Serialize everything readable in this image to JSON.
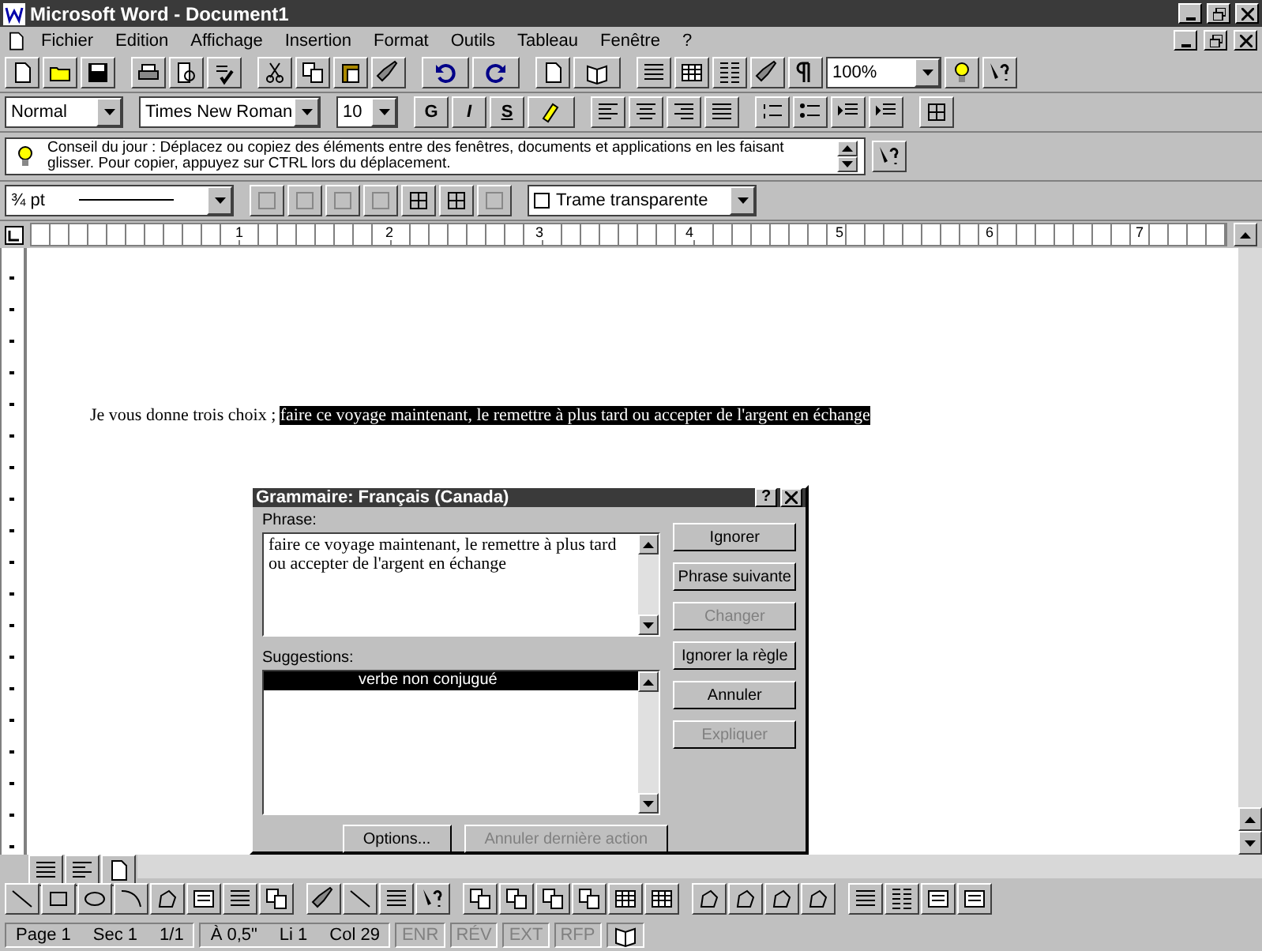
{
  "window": {
    "title": "Microsoft Word - Document1"
  },
  "menu": [
    "Fichier",
    "Edition",
    "Affichage",
    "Insertion",
    "Format",
    "Outils",
    "Tableau",
    "Fenêtre",
    "?"
  ],
  "standard_toolbar": {
    "zoom": "100%"
  },
  "formatting_toolbar": {
    "style": "Normal",
    "font": "Times New Roman",
    "size": "10",
    "bold": "G",
    "italic": "I",
    "underline": "S"
  },
  "tip_of_the_day": {
    "text": "Conseil du jour : Déplacez ou copiez des éléments entre des fenêtres, documents et applications en les faisant glisser. Pour copier, appuyez sur CTRL lors du déplacement."
  },
  "borders_toolbar": {
    "line_weight": "¾ pt",
    "shading": "Trame transparente"
  },
  "ruler": [
    "1",
    "2",
    "3",
    "4",
    "5",
    "6",
    "7"
  ],
  "document": {
    "text": "Je vous donne trois choix ; ",
    "selected_text": "faire ce voyage maintenant, le remettre à plus tard ou accepter de l'argent en échange"
  },
  "dialog": {
    "title": "Grammaire: Français (Canada)",
    "help": "?",
    "phrase_label": "Phrase:",
    "phrase": "faire ce voyage maintenant, le remettre à plus tard ou accepter de l'argent en échange",
    "suggestions_label": "Suggestions:",
    "suggestions": [
      {
        "text": "verbe non conjugué",
        "selected": true
      }
    ],
    "buttons": [
      {
        "label": "Ignorer",
        "disabled": false
      },
      {
        "label": "Phrase suivante",
        "disabled": false
      },
      {
        "label": "Changer",
        "disabled": true
      },
      {
        "label": "Ignorer la règle",
        "disabled": false
      },
      {
        "label": "Annuler",
        "disabled": false
      },
      {
        "label": "Expliquer",
        "disabled": true
      }
    ],
    "bottom_buttons": [
      {
        "label": "Options...",
        "disabled": false
      },
      {
        "label": "Annuler dernière action",
        "disabled": true
      }
    ]
  },
  "status_bar": {
    "groups": [
      [
        "Page 1",
        "Sec 1",
        "1/1"
      ],
      [
        "À 0,5\"",
        "Li 1",
        "Col 29"
      ]
    ],
    "modes": [
      {
        "label": "ENR",
        "disabled": true
      },
      {
        "label": "RÉV",
        "disabled": true
      },
      {
        "label": "EXT",
        "disabled": true
      },
      {
        "label": "RFP",
        "disabled": true
      }
    ]
  }
}
